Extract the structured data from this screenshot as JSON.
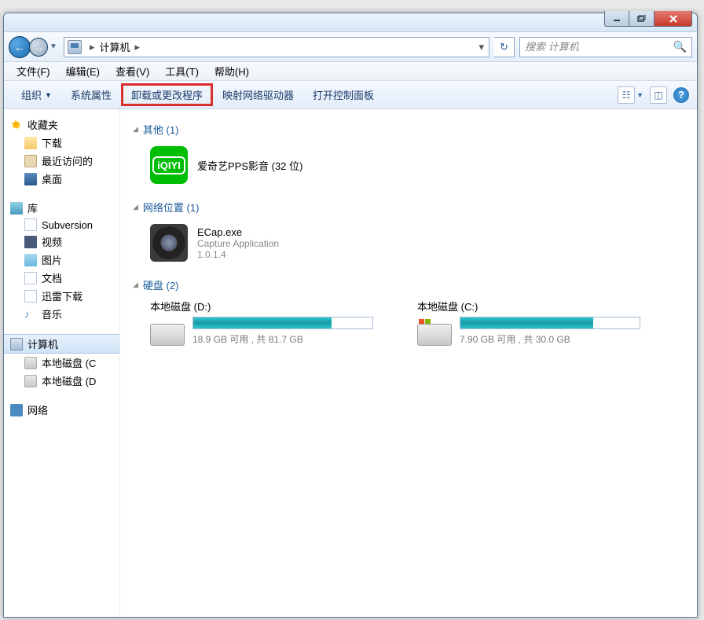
{
  "window": {
    "min_tip": "最小化",
    "max_tip": "还原",
    "close_tip": "关闭"
  },
  "nav": {
    "location_label": "计算机",
    "search_placeholder": "搜索 计算机"
  },
  "menubar": {
    "file": "文件(F)",
    "edit": "编辑(E)",
    "view": "查看(V)",
    "tools": "工具(T)",
    "help": "帮助(H)"
  },
  "toolbar": {
    "organize": "组织",
    "sys_props": "系统属性",
    "uninstall": "卸载或更改程序",
    "map_drive": "映射网络驱动器",
    "open_ctrl": "打开控制面板"
  },
  "sidebar": {
    "favorites": "收藏夹",
    "fav_items": [
      "下载",
      "最近访问的",
      "桌面"
    ],
    "libraries": "库",
    "lib_items": [
      "Subversion",
      "视频",
      "图片",
      "文档",
      "迅雷下载",
      "音乐"
    ],
    "computer": "计算机",
    "comp_items": [
      "本地磁盘 (C",
      "本地磁盘 (D"
    ],
    "network": "网络"
  },
  "content": {
    "groups": [
      {
        "title": "其他 (1)",
        "type": "app",
        "items": [
          {
            "name": "爱奇艺PPS影音 (32 位)"
          }
        ]
      },
      {
        "title": "网络位置 (1)",
        "type": "net",
        "items": [
          {
            "name": "ECap.exe",
            "desc": "Capture Application",
            "ver": "1.0.1.4"
          }
        ]
      },
      {
        "title": "硬盘 (2)",
        "type": "drives",
        "items": [
          {
            "name": "本地磁盘 (D:)",
            "free": "18.9 GB 可用 , 共 81.7 GB",
            "pct": 77,
            "os": false
          },
          {
            "name": "本地磁盘 (C:)",
            "free": "7.90 GB 可用 , 共 30.0 GB",
            "pct": 74,
            "os": true
          }
        ]
      }
    ]
  }
}
